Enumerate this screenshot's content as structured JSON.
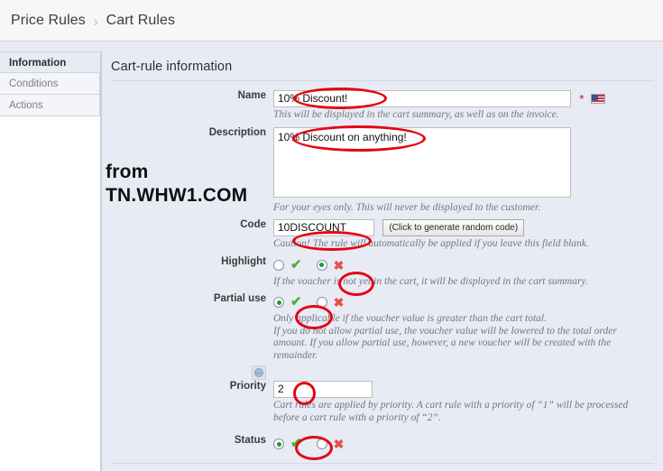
{
  "breadcrumb": {
    "parent": "Price Rules",
    "separator": "›",
    "current": "Cart Rules"
  },
  "tabs": [
    {
      "label": "Information",
      "active": true
    },
    {
      "label": "Conditions",
      "active": false
    },
    {
      "label": "Actions",
      "active": false
    }
  ],
  "panel": {
    "title": "Cart-rule information"
  },
  "watermark": {
    "line1": "from",
    "line2": "TN.WHW1.COM"
  },
  "form": {
    "name": {
      "label": "Name",
      "value": "10% Discount!",
      "required_mark": "*",
      "flag_icon": "us-flag-icon",
      "hint": "This will be displayed in the cart summary, as well as on the invoice."
    },
    "description": {
      "label": "Description",
      "value": "10% Discount on anything!",
      "hint": "For your eyes only. This will never be displayed to the customer."
    },
    "code": {
      "label": "Code",
      "value": "10DISCOUNT",
      "button_label": "(Click to generate random code)",
      "hint": "Caution! The rule will automatically be applied if you leave this field blank."
    },
    "highlight": {
      "label": "Highlight",
      "yes_icon": "check-icon",
      "no_icon": "cross-icon",
      "selected": "no",
      "hint": "If the voucher is not yet in the cart, it will be displayed in the cart summary."
    },
    "partial_use": {
      "label": "Partial use",
      "yes_icon": "check-icon",
      "no_icon": "cross-icon",
      "selected": "yes",
      "hint": "Only applicable if the voucher value is greater than the cart total.\nIf you do not allow partial use, the voucher value will be lowered to the total order amount. If you allow partial use, however, a new voucher will be created with the remainder."
    },
    "priority": {
      "label": "Priority",
      "value": "2",
      "icon": "globe-icon",
      "hint": "Cart rules are applied by priority. A cart rule with a priority of “1” will be processed before a cart rule with a priority of “2”."
    },
    "status": {
      "label": "Status",
      "yes_icon": "check-icon",
      "no_icon": "cross-icon",
      "selected": "yes"
    }
  },
  "annotations": {
    "color": "#e30613",
    "shape": "ellipse",
    "targets": [
      "name-value",
      "description-value",
      "code-value",
      "highlight-no-radio",
      "partial-use-yes-radio",
      "priority-value",
      "status-yes-radio"
    ]
  },
  "glyphs": {
    "check": "✔",
    "cross": "✖"
  }
}
